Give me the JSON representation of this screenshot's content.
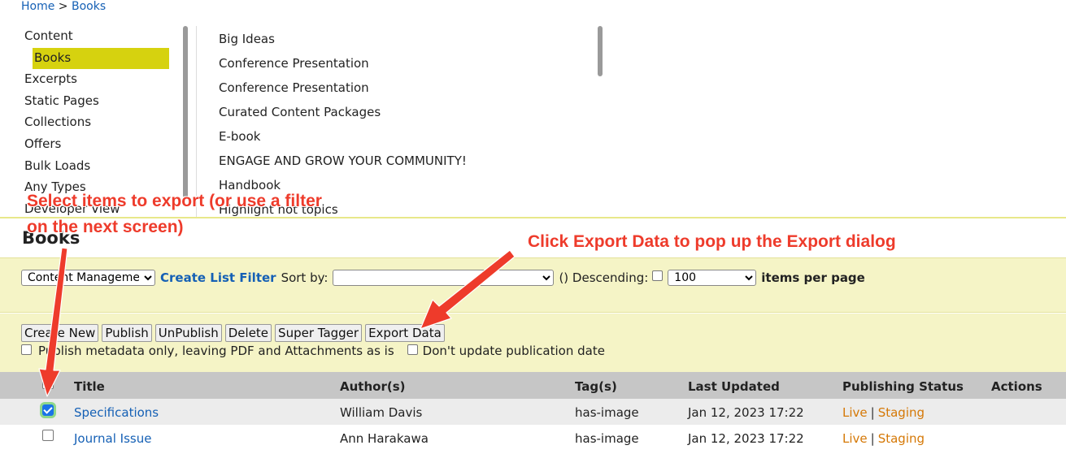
{
  "breadcrumb": {
    "home": "Home",
    "separator": ">",
    "current": "Books"
  },
  "sidebar": {
    "items": [
      {
        "label": "Content"
      },
      {
        "label": "Books",
        "selected": true
      },
      {
        "label": "Excerpts"
      },
      {
        "label": "Static Pages"
      },
      {
        "label": "Collections"
      },
      {
        "label": "Offers"
      },
      {
        "label": "Bulk Loads"
      },
      {
        "label": "Any Types"
      },
      {
        "label": "Developer View"
      }
    ]
  },
  "content_types": [
    "Big Ideas",
    "Conference Presentation",
    "Conference Presentation",
    "Curated Content Packages",
    "E-book",
    "ENGAGE AND GROW YOUR COMMUNITY!",
    "Handbook",
    "Highlight hot topics"
  ],
  "section_title": "Books",
  "filter_bar": {
    "management_select": "Content Management",
    "create_filter_link": "Create List Filter",
    "sort_by_label": "Sort by:",
    "sort_by_value": "",
    "descending_label": "() Descending:",
    "per_page_value": "100",
    "per_page_label": "items per page"
  },
  "actions": {
    "create_new": "Create New",
    "publish": "Publish",
    "unpublish": "UnPublish",
    "delete": "Delete",
    "super_tagger": "Super Tagger",
    "export_data": "Export Data",
    "option_metadata": "Publish metadata only, leaving PDF and Attachments as is",
    "option_no_update": "Don't update publication date"
  },
  "table": {
    "headers": {
      "title": "Title",
      "authors": "Author(s)",
      "tags": "Tag(s)",
      "updated": "Last Updated",
      "status": "Publishing Status",
      "actions": "Actions"
    },
    "rows": [
      {
        "checked": true,
        "title": "Specifications",
        "author": "William Davis",
        "tags": "has-image",
        "updated": "Jan 12, 2023 17:22",
        "live": "Live",
        "sep": "|",
        "staging": "Staging"
      },
      {
        "checked": false,
        "title": "Journal Issue",
        "author": "Ann Harakawa",
        "tags": "has-image",
        "updated": "Jan 12, 2023 17:22",
        "live": "Live",
        "sep": "|",
        "staging": "Staging"
      }
    ]
  },
  "annotations": {
    "select_items_line1": "Select items to export (or use a filter",
    "select_items_line2": "on the next screen)",
    "export_hint": "Click Export Data to pop up the Export dialog"
  },
  "colors": {
    "selected_highlight": "#d6d20f",
    "panel_bg": "#f5f4c6",
    "link_blue": "#1560b5",
    "status_orange": "#d57806",
    "annotation_red": "#ee3b2b"
  }
}
